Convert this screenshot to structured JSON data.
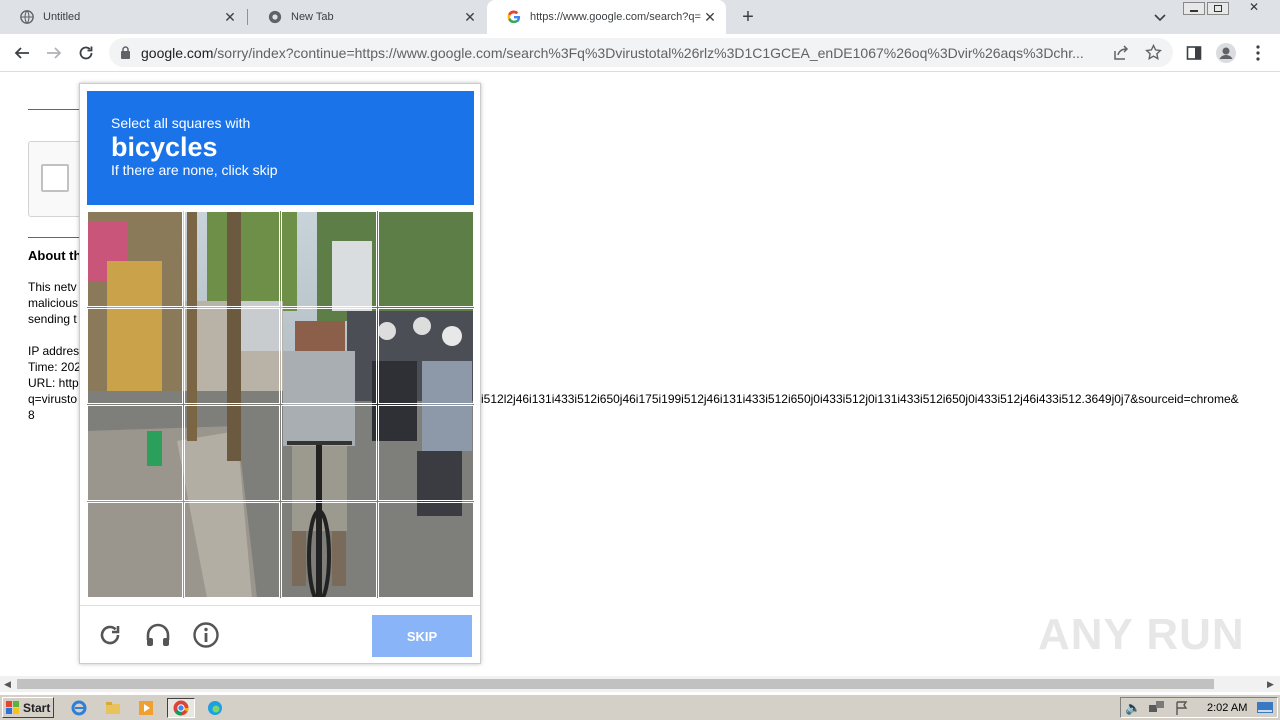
{
  "tabs": [
    {
      "title": "Untitled",
      "icon": "globe-icon"
    },
    {
      "title": "New Tab",
      "icon": "chrome-icon"
    },
    {
      "title": "https://www.google.com/search?q=",
      "icon": "google-icon"
    }
  ],
  "toolbar": {
    "url_host": "google.com",
    "url_rest": "/sorry/index?continue=https://www.google.com/search%3Fq%3Dvirustotal%26rlz%3D1C1GCEA_enDE1067%26oq%3Dvir%26aqs%3Dchr..."
  },
  "page": {
    "about_heading": "About th",
    "para_lines": [
      "This netv",
      "malicious",
      "sending t"
    ],
    "ip_label": "IP addres",
    "time_label": "Time: 202",
    "url_label": "URL: http",
    "query_start": "q=virusto",
    "query_tail": "i512l2j46i131i433i512i650j46i175i199i512j46i131i433i512i650j0i433i512j0i131i433i512i650j0i433i512j46i433i512.3649j0j7&sourceid=chrome&",
    "trail": "8"
  },
  "captcha": {
    "instruction": "Select all squares with",
    "target": "bicycles",
    "hint": "If there are none, click skip",
    "skip_label": "SKIP"
  },
  "taskbar": {
    "start_label": "Start",
    "clock": "2:02 AM"
  },
  "watermark": "ANY RUN"
}
